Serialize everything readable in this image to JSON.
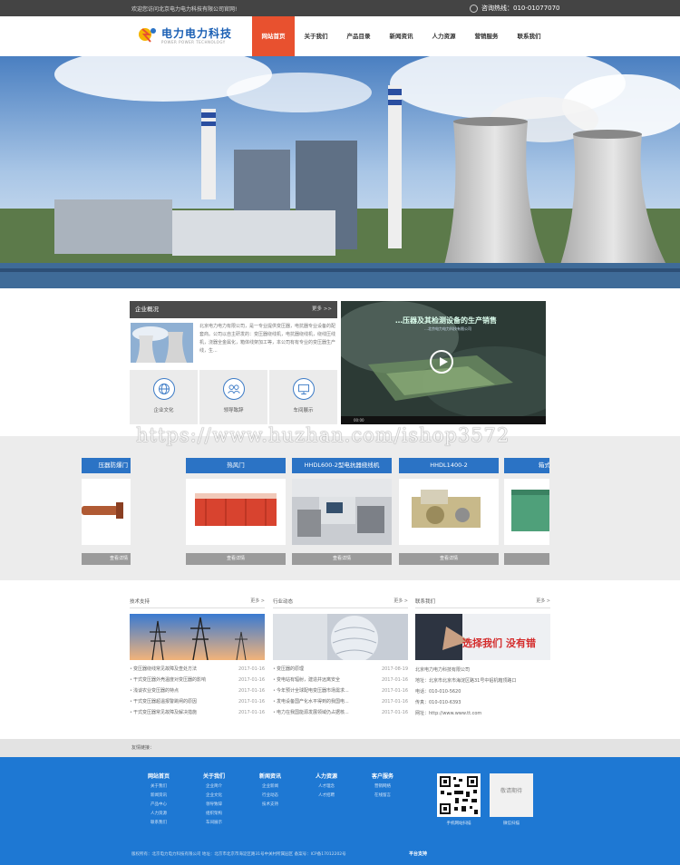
{
  "topbar": {
    "welcome": "欢迎您访问北京电力电力科技有限公司官网!",
    "hotline": "咨询热线：010-01077070"
  },
  "logo": {
    "name": "电力电力科技",
    "sub": "POWER POWER TECHNOLOGY"
  },
  "nav": {
    "items": [
      "网站首页",
      "关于我们",
      "产品目录",
      "新闻资讯",
      "人力资源",
      "营销服务",
      "联系我们"
    ]
  },
  "about": {
    "title": "企业概况",
    "more": "更多 >>",
    "text": "北京电力电力有限公司，是一专业提供变压器，电抗器专业设备的配套商。公司以自主研发的：变压器绕线机，电抗器绕线机，绕线压线机，浇器全金属化，箱体线架加工等，本公司有有专业的变压器生产线，生...",
    "icons": [
      {
        "label": "企业文化",
        "icon": "globe-icon"
      },
      {
        "label": "领导致辞",
        "icon": "people-icon"
      },
      {
        "label": "车间展示",
        "icon": "monitor-icon"
      }
    ]
  },
  "video": {
    "caption": "…压器及其检测设备的生产销售",
    "caption2": "…北京电力电力科技有限公司",
    "time": "00:00"
  },
  "watermark": "https://www.huzhan.com/ishop3572",
  "products": [
    {
      "title": "压器防爆门",
      "btn": "查看详情"
    },
    {
      "title": "热风门",
      "btn": "查看详情"
    },
    {
      "title": "HHDL600-2型电抗器绕线机",
      "btn": "查看详情"
    },
    {
      "title": "HHDL1400-2",
      "btn": "查看详情"
    },
    {
      "title": "箱式",
      "btn": "查看详情"
    }
  ],
  "tech": {
    "title": "技术支持",
    "more": "更多 >",
    "items": [
      {
        "t": "变压器绕线常见故障及查处方法",
        "d": "2017-01-16"
      },
      {
        "t": "干式变压器外壳温度对变压器的影响",
        "d": "2017-01-16"
      },
      {
        "t": "浅谈农业变压器的特点",
        "d": "2017-01-16"
      },
      {
        "t": "干式变压器超温报警跳闸的原因",
        "d": "2017-01-16"
      },
      {
        "t": "干式变压器常见故障及解决措施",
        "d": "2017-01-16"
      }
    ]
  },
  "industry": {
    "title": "行业动态",
    "more": "更多 >",
    "items": [
      {
        "t": "变压器的原理",
        "d": "2017-08-19"
      },
      {
        "t": "变电站有辐射，建造并远离安全",
        "d": "2017-01-16"
      },
      {
        "t": "今年预计全球配电变压器市场需求...",
        "d": "2017-01-16"
      },
      {
        "t": "发电设备国产化水平得到的我国电...",
        "d": "2017-01-16"
      },
      {
        "t": "电力在我国能源发展领域仍占据核...",
        "d": "2017-01-16"
      }
    ]
  },
  "contact": {
    "title": "联系我们",
    "more": "更多 >",
    "lines": [
      "北京电力电力科技有限公司",
      "地址：北京市北京市海淀区路31号中铝机箱顶路口",
      "电话：010-010-5620",
      "传真：010-010-6393",
      "网址：http://www.www.tt.com"
    ]
  },
  "links": {
    "label": "友情链接："
  },
  "footer": {
    "cols": [
      {
        "h": "网站首页",
        "items": [
          "关于我们",
          "新闻资讯",
          "产品中心",
          "人力资源",
          "联系我们"
        ]
      },
      {
        "h": "关于我们",
        "items": [
          "企业简介",
          "企业文化",
          "领导致辞",
          "组织架构",
          "车间展示"
        ]
      },
      {
        "h": "新闻资讯",
        "items": [
          "企业新闻",
          "行业动态",
          "技术支持"
        ]
      },
      {
        "h": "人力资源",
        "items": [
          "人才理念",
          "人才招聘"
        ]
      },
      {
        "h": "客户服务",
        "items": [
          "营销网络",
          "在线留言"
        ]
      }
    ],
    "qr": [
      {
        "label": "手机网站扫描"
      },
      {
        "label": "微信扫描",
        "placeholder": "敬请期待"
      }
    ],
    "copyright": "版权所有：北京电力电力科技有限公司    地址：北京市北京市海淀区路31号中关村所属园区    备案号：ICP备17012202号",
    "support": "平台支持"
  }
}
